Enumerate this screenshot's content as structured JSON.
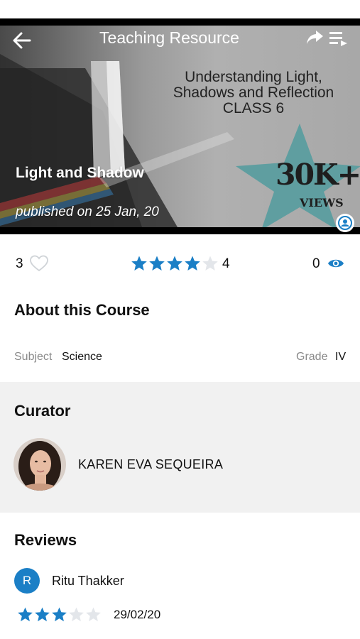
{
  "header": {
    "title": "Teaching Resource"
  },
  "hero": {
    "poster_lines": [
      "Understanding Light,",
      "Shadows and Reflection",
      "CLASS 6"
    ],
    "course_title": "Light and Shadow",
    "published": "published on 25 Jan, 20",
    "badge_big": "30K+",
    "badge_small": "VIEWS"
  },
  "stats": {
    "likes": "3",
    "rating_stars": 4,
    "rating_max": 5,
    "rating_value": "4",
    "views": "0"
  },
  "about": {
    "heading": "About this Course",
    "subject_label": "Subject",
    "subject_value": "Science",
    "grade_label": "Grade",
    "grade_value": "IV"
  },
  "curator": {
    "heading": "Curator",
    "name": "KAREN EVA SEQUEIRA"
  },
  "reviews": {
    "heading": "Reviews",
    "items": [
      {
        "initial": "R",
        "name": "Ritu Thakker",
        "stars": 3,
        "max": 5,
        "date": "29/02/20"
      }
    ]
  },
  "colors": {
    "accent": "#1b7fc6",
    "star_empty": "#e3e6ea",
    "badge_star": "#5f9ea0",
    "curator_bg": "#f1f1f1"
  }
}
